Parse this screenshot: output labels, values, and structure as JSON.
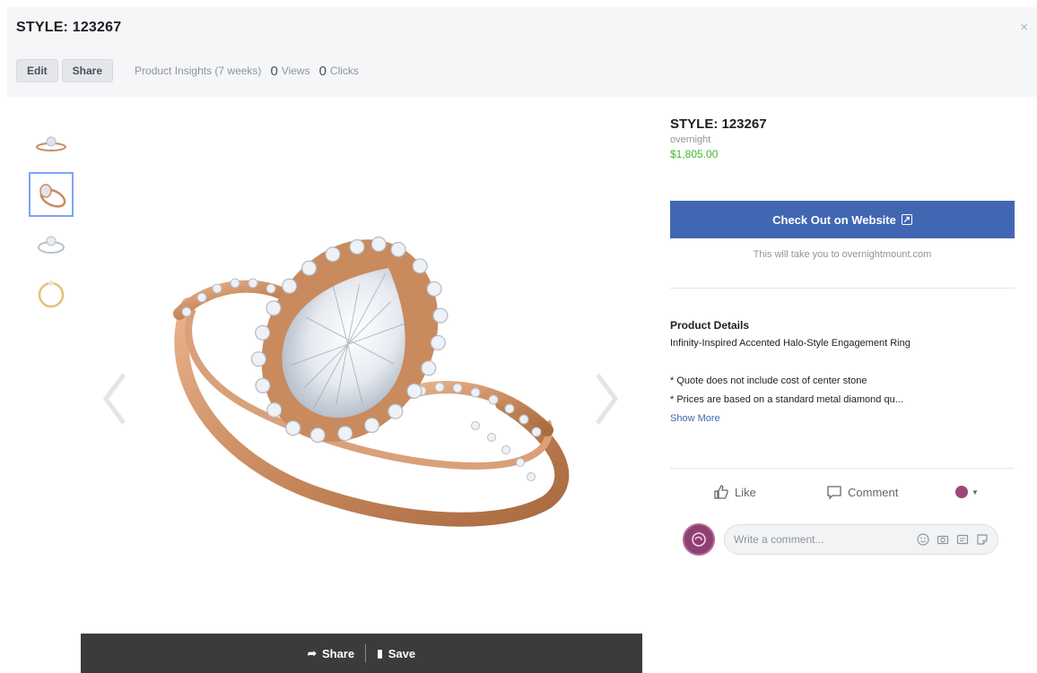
{
  "header": {
    "title": "STYLE: 123267",
    "close": "×",
    "toolbar": {
      "edit": "Edit",
      "share": "Share"
    },
    "insights": {
      "label": "Product Insights (7 weeks)",
      "views_count": "0",
      "views_label": "Views",
      "clicks_count": "0",
      "clicks_label": "Clicks"
    }
  },
  "gallery": {
    "thumbnails": [
      "ring-side-view",
      "ring-angled-view",
      "ring-profile-view",
      "ring-top-view"
    ],
    "selected_index": 1
  },
  "bottom_bar": {
    "share": "Share",
    "save": "Save"
  },
  "product": {
    "title": "STYLE: 123267",
    "seller": "overnight",
    "price": "$1,805.00",
    "checkout_label": "Check Out on Website",
    "checkout_note": "This will take you to overnightmount.com",
    "details_heading": "Product Details",
    "details_lines": [
      "Infinity-Inspired Accented Halo-Style Engagement Ring",
      "",
      "* Quote does not include cost of center stone",
      "* Prices are based on a standard metal diamond qu..."
    ],
    "show_more": "Show More"
  },
  "social": {
    "like": "Like",
    "comment": "Comment",
    "comment_placeholder": "Write a comment..."
  },
  "colors": {
    "primary": "#4267b2",
    "price": "#42b72a",
    "avatar": "#8e3f73",
    "gold": "#c98a5e",
    "bar": "#3b3b3b"
  }
}
